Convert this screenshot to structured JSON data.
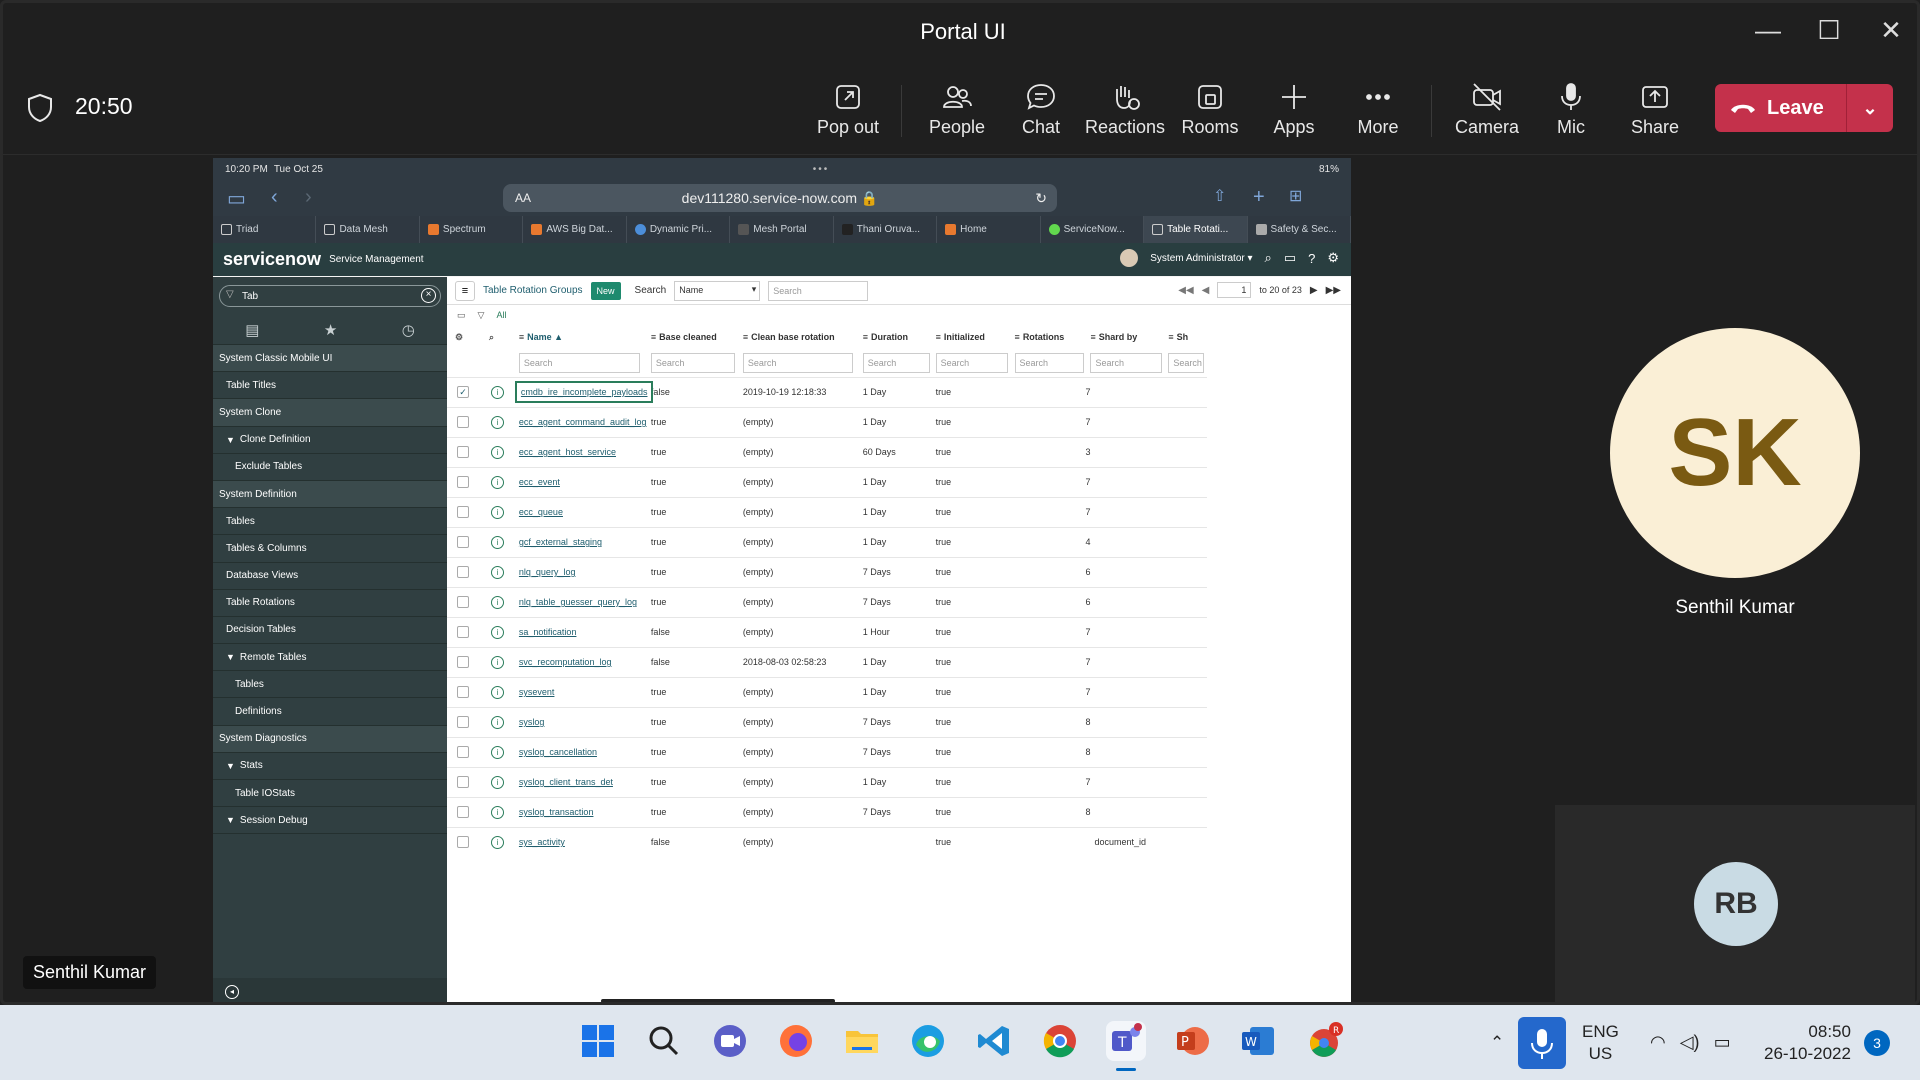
{
  "window": {
    "title": "Portal UI",
    "controls": [
      "—",
      "☐",
      "✕"
    ]
  },
  "meeting": {
    "elapsed": "20:50"
  },
  "toolbar": {
    "items": [
      {
        "label": "Pop out",
        "icon": "pop-out-icon"
      },
      {
        "label": "People",
        "icon": "people-icon"
      },
      {
        "label": "Chat",
        "icon": "chat-icon"
      },
      {
        "label": "Reactions",
        "icon": "reactions-icon"
      },
      {
        "label": "Rooms",
        "icon": "rooms-icon"
      },
      {
        "label": "Apps",
        "icon": "apps-icon"
      },
      {
        "label": "More",
        "icon": "more-icon"
      },
      {
        "label": "Camera",
        "icon": "camera-off-icon"
      },
      {
        "label": "Mic",
        "icon": "mic-icon"
      },
      {
        "label": "Share",
        "icon": "share-icon"
      }
    ],
    "leave_label": "Leave",
    "leave_color": "#c4314b"
  },
  "ipad": {
    "status_time": "10:20 PM",
    "status_date": "Tue Oct 25",
    "status_battery": "81%",
    "url_aa": "AA",
    "url": "dev111280.service-now.com 🔒",
    "tabs": [
      "Triad",
      "Data Mesh",
      "Spectrum",
      "AWS Big Dat...",
      "Dynamic Pri...",
      "Mesh Portal",
      "Thani Oruva...",
      "Home",
      "ServiceNow...",
      "Table Rotati...",
      "Safety & Sec..."
    ]
  },
  "sn": {
    "logo": "servicenow",
    "subtitle": "Service Management",
    "user": "System Administrator ▾",
    "filter_value": "Tab",
    "nav": [
      {
        "label": "System Classic Mobile UI",
        "level": "mod"
      },
      {
        "label": "Table Titles",
        "level": "l1"
      },
      {
        "label": "System Clone",
        "level": "mod"
      },
      {
        "label": "Clone Definition",
        "level": "l1",
        "tri": "▼"
      },
      {
        "label": "Exclude Tables",
        "level": "l2"
      },
      {
        "label": "System Definition",
        "level": "mod"
      },
      {
        "label": "Tables",
        "level": "l1"
      },
      {
        "label": "Tables & Columns",
        "level": "l1"
      },
      {
        "label": "Database Views",
        "level": "l1"
      },
      {
        "label": "Table Rotations",
        "level": "l1"
      },
      {
        "label": "Decision Tables",
        "level": "l1"
      },
      {
        "label": "Remote Tables",
        "level": "l1",
        "tri": "▼"
      },
      {
        "label": "Tables",
        "level": "l2"
      },
      {
        "label": "Definitions",
        "level": "l2"
      },
      {
        "label": "System Diagnostics",
        "level": "mod"
      },
      {
        "label": "Stats",
        "level": "l1",
        "tri": "▼"
      },
      {
        "label": "Table IOStats",
        "level": "l2"
      },
      {
        "label": "Session Debug",
        "level": "l1",
        "tri": "▼"
      }
    ],
    "list": {
      "title": "Table Rotation Groups",
      "new_label": "New",
      "search_label": "Search",
      "search_field": "Name",
      "search_placeholder": "Search",
      "page_value": "1",
      "page_range": "to 20 of 23",
      "filter_all": "All",
      "columns": [
        "Name ▲",
        "Base cleaned",
        "Clean base rotation",
        "Duration",
        "Initialized",
        "Rotations",
        "Shard by",
        "Sh"
      ],
      "rows": [
        {
          "name": "cmdb_ire_incomplete_payloads",
          "base_cleaned": "false",
          "clean_base_rotation": "2019-10-19 12:18:33",
          "duration": "1 Day",
          "initialized": "true",
          "rotations": "7",
          "shard_by": "",
          "checked": true
        },
        {
          "name": "ecc_agent_command_audit_log",
          "base_cleaned": "true",
          "clean_base_rotation": "(empty)",
          "duration": "1 Day",
          "initialized": "true",
          "rotations": "7",
          "shard_by": ""
        },
        {
          "name": "ecc_agent_host_service",
          "base_cleaned": "true",
          "clean_base_rotation": "(empty)",
          "duration": "60 Days",
          "initialized": "true",
          "rotations": "3",
          "shard_by": ""
        },
        {
          "name": "ecc_event",
          "base_cleaned": "true",
          "clean_base_rotation": "(empty)",
          "duration": "1 Day",
          "initialized": "true",
          "rotations": "7",
          "shard_by": ""
        },
        {
          "name": "ecc_queue",
          "base_cleaned": "true",
          "clean_base_rotation": "(empty)",
          "duration": "1 Day",
          "initialized": "true",
          "rotations": "7",
          "shard_by": ""
        },
        {
          "name": "gcf_external_staging",
          "base_cleaned": "true",
          "clean_base_rotation": "(empty)",
          "duration": "1 Day",
          "initialized": "true",
          "rotations": "4",
          "shard_by": ""
        },
        {
          "name": "nlq_query_log",
          "base_cleaned": "true",
          "clean_base_rotation": "(empty)",
          "duration": "7 Days",
          "initialized": "true",
          "rotations": "6",
          "shard_by": ""
        },
        {
          "name": "nlq_table_guesser_query_log",
          "base_cleaned": "true",
          "clean_base_rotation": "(empty)",
          "duration": "7 Days",
          "initialized": "true",
          "rotations": "6",
          "shard_by": ""
        },
        {
          "name": "sa_notification",
          "base_cleaned": "false",
          "clean_base_rotation": "(empty)",
          "duration": "1 Hour",
          "initialized": "true",
          "rotations": "7",
          "shard_by": ""
        },
        {
          "name": "svc_recomputation_log",
          "base_cleaned": "false",
          "clean_base_rotation": "2018-08-03 02:58:23",
          "duration": "1 Day",
          "initialized": "true",
          "rotations": "7",
          "shard_by": ""
        },
        {
          "name": "sysevent",
          "base_cleaned": "true",
          "clean_base_rotation": "(empty)",
          "duration": "1 Day",
          "initialized": "true",
          "rotations": "7",
          "shard_by": ""
        },
        {
          "name": "syslog",
          "base_cleaned": "true",
          "clean_base_rotation": "(empty)",
          "duration": "7 Days",
          "initialized": "true",
          "rotations": "8",
          "shard_by": ""
        },
        {
          "name": "syslog_cancellation",
          "base_cleaned": "true",
          "clean_base_rotation": "(empty)",
          "duration": "7 Days",
          "initialized": "true",
          "rotations": "8",
          "shard_by": ""
        },
        {
          "name": "syslog_client_trans_det",
          "base_cleaned": "true",
          "clean_base_rotation": "(empty)",
          "duration": "1 Day",
          "initialized": "true",
          "rotations": "7",
          "shard_by": ""
        },
        {
          "name": "syslog_transaction",
          "base_cleaned": "true",
          "clean_base_rotation": "(empty)",
          "duration": "7 Days",
          "initialized": "true",
          "rotations": "8",
          "shard_by": ""
        },
        {
          "name": "sys_activity",
          "base_cleaned": "false",
          "clean_base_rotation": "(empty)",
          "duration": "",
          "initialized": "true",
          "rotations": "",
          "shard_by": "document_id"
        }
      ]
    }
  },
  "participants": {
    "main": {
      "initials": "SK",
      "name": "Senthil Kumar"
    },
    "secondary": {
      "initials": "RB"
    },
    "self_name": "Senthil Kumar"
  },
  "taskbar": {
    "apps": [
      "windows-start-icon",
      "search-icon",
      "meet-icon",
      "firefox-icon",
      "file-explorer-icon",
      "edge-icon",
      "vscode-icon",
      "chrome-icon",
      "teams-icon",
      "powerpoint-icon",
      "word-icon",
      "chrome-profile-icon"
    ],
    "lang1": "ENG",
    "lang2": "US",
    "time": "08:50",
    "date": "26-10-2022",
    "notifications": "3"
  }
}
